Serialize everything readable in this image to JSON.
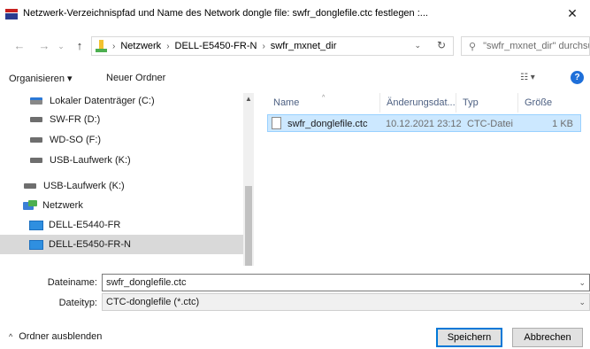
{
  "window": {
    "title": "Netzwerk-Verzeichnispfad und Name des Network dongle file: swfr_donglefile.ctc festlegen :...",
    "close": "✕"
  },
  "address": {
    "crumbs": [
      "Netzwerk",
      "DELL-E5450-FR-N",
      "swfr_mxnet_dir"
    ],
    "search_placeholder": "\"swfr_mxnet_dir\" durchsuch..."
  },
  "toolbar": {
    "organize": "Organisieren ▾",
    "new_folder": "Neuer Ordner",
    "help": "?"
  },
  "nav": {
    "items": [
      {
        "label": "Lokaler Datenträger (C:)",
        "type": "sys"
      },
      {
        "label": "SW-FR (D:)",
        "type": "drive"
      },
      {
        "label": "WD-SO (F:)",
        "type": "drive"
      },
      {
        "label": "USB-Laufwerk (K:)",
        "type": "drive"
      },
      {
        "label": "USB-Laufwerk (K:)",
        "type": "drive"
      },
      {
        "label": "Netzwerk",
        "type": "network"
      },
      {
        "label": "DELL-E5440-FR",
        "type": "pc"
      },
      {
        "label": "DELL-E5450-FR-N",
        "type": "pc",
        "selected": true
      }
    ]
  },
  "filelist": {
    "columns": {
      "name": "Name",
      "date": "Änderungsdat...",
      "type": "Typ",
      "size": "Größe"
    },
    "rows": [
      {
        "name": "swfr_donglefile.ctc",
        "date": "10.12.2021 23:12",
        "type": "CTC-Datei",
        "size": "1 KB"
      }
    ]
  },
  "fields": {
    "filename_label": "Dateiname:",
    "filename_value": "swfr_donglefile.ctc",
    "filetype_label": "Dateityp:",
    "filetype_value": "CTC-donglefile (*.ctc)"
  },
  "footer": {
    "hide_folders": "Ordner ausblenden",
    "save": "Speichern",
    "cancel": "Abbrechen"
  }
}
